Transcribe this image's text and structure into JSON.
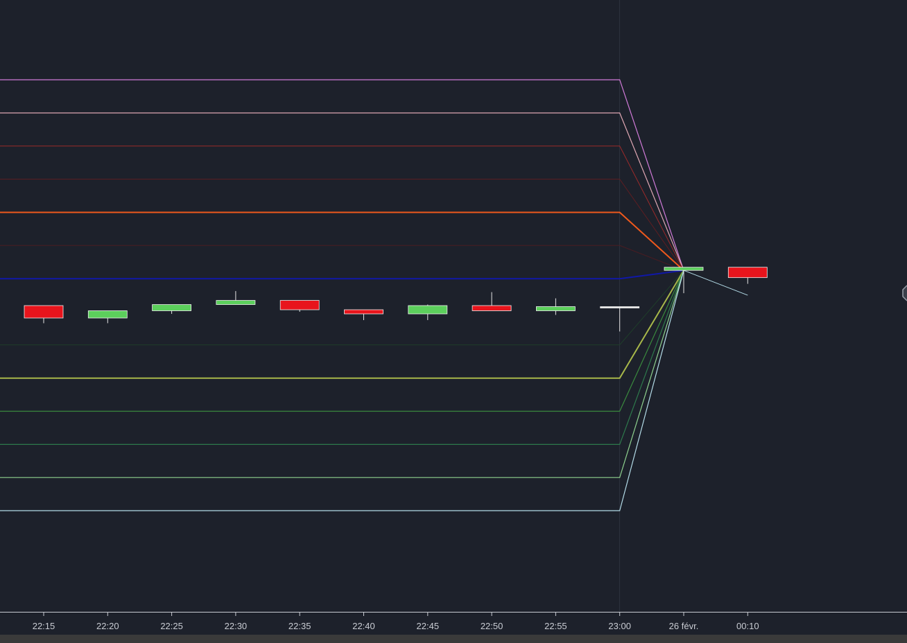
{
  "chart_data": {
    "type": "line",
    "x_ticks": [
      "22:15",
      "22:20",
      "22:25",
      "22:30",
      "22:35",
      "22:40",
      "22:45",
      "22:50",
      "22:55",
      "23:00",
      "26 févr.",
      "00:10"
    ],
    "grid": false,
    "candles": [
      {
        "time": "22:15",
        "open": 0.3,
        "close": -0.3,
        "high": 0.3,
        "low": -0.55,
        "color": "#e8141c"
      },
      {
        "time": "22:20",
        "open": -0.3,
        "close": 0.05,
        "high": 0.05,
        "low": -0.55,
        "color": "#5ccf5c"
      },
      {
        "time": "22:25",
        "open": 0.05,
        "close": 0.35,
        "high": 0.35,
        "low": -0.1,
        "color": "#5ccf5c"
      },
      {
        "time": "22:30",
        "open": 0.35,
        "close": 0.55,
        "high": 1.0,
        "low": 0.35,
        "color": "#5ccf5c"
      },
      {
        "time": "22:35",
        "open": 0.55,
        "close": 0.1,
        "high": 0.55,
        "low": 0.0,
        "color": "#e8141c"
      },
      {
        "time": "22:40",
        "open": 0.1,
        "close": -0.1,
        "high": 0.1,
        "low": -0.4,
        "color": "#e8141c"
      },
      {
        "time": "22:45",
        "open": -0.1,
        "close": 0.3,
        "high": 0.35,
        "low": -0.4,
        "color": "#5ccf5c"
      },
      {
        "time": "22:50",
        "open": 0.3,
        "close": 0.05,
        "high": 0.95,
        "low": 0.05,
        "color": "#e8141c"
      },
      {
        "time": "22:55",
        "open": 0.05,
        "close": 0.25,
        "high": 0.65,
        "low": -0.15,
        "color": "#5ccf5c"
      },
      {
        "time": "23:00",
        "open": 0.25,
        "close": 0.25,
        "high": 0.25,
        "low": -0.95,
        "color": "#e6e6e6"
      },
      {
        "time": "26 févr.",
        "open": 2.0,
        "close": 2.15,
        "high": 2.15,
        "low": 0.9,
        "color": "#5ccf5c"
      },
      {
        "time": "00:10",
        "open": 2.15,
        "close": 1.65,
        "high": 2.15,
        "low": 1.35,
        "color": "#e8141c"
      }
    ],
    "series": [
      {
        "color": "#d17bd9",
        "width": 1.2,
        "values": [
          11.2,
          11.2,
          11.2,
          11.2,
          11.2,
          11.2,
          11.2,
          11.2,
          11.2,
          11.2,
          2.0
        ]
      },
      {
        "color": "#e0a8b4",
        "width": 1.2,
        "values": [
          9.6,
          9.6,
          9.6,
          9.6,
          9.6,
          9.6,
          9.6,
          9.6,
          9.6,
          9.6,
          2.0
        ]
      },
      {
        "color": "#9c2a2a",
        "width": 1.0,
        "values": [
          8.0,
          8.0,
          8.0,
          8.0,
          8.0,
          8.0,
          8.0,
          8.0,
          8.0,
          8.0,
          2.0
        ]
      },
      {
        "color": "#5e1e22",
        "width": 1.0,
        "values": [
          6.4,
          6.4,
          6.4,
          6.4,
          6.4,
          6.4,
          6.4,
          6.4,
          6.4,
          6.4,
          2.0
        ]
      },
      {
        "color": "#f0591c",
        "width": 2.0,
        "values": [
          4.8,
          4.8,
          4.8,
          4.8,
          4.8,
          4.8,
          4.8,
          4.8,
          4.8,
          4.8,
          2.0
        ]
      },
      {
        "color": "#4a1c22",
        "width": 1.0,
        "values": [
          3.2,
          3.2,
          3.2,
          3.2,
          3.2,
          3.2,
          3.2,
          3.2,
          3.2,
          3.2,
          2.0
        ]
      },
      {
        "color": "#1018a8",
        "width": 2.0,
        "values": [
          1.6,
          1.6,
          1.6,
          1.6,
          1.6,
          1.6,
          1.6,
          1.6,
          1.6,
          1.6,
          2.0
        ]
      },
      {
        "color": "#1f3f2a",
        "width": 1.0,
        "values": [
          -1.6,
          -1.6,
          -1.6,
          -1.6,
          -1.6,
          -1.6,
          -1.6,
          -1.6,
          -1.6,
          -1.6,
          2.0
        ]
      },
      {
        "color": "#a8b84a",
        "width": 2.0,
        "values": [
          -3.2,
          -3.2,
          -3.2,
          -3.2,
          -3.2,
          -3.2,
          -3.2,
          -3.2,
          -3.2,
          -3.2,
          2.0
        ]
      },
      {
        "color": "#3a8a3e",
        "width": 1.2,
        "values": [
          -4.8,
          -4.8,
          -4.8,
          -4.8,
          -4.8,
          -4.8,
          -4.8,
          -4.8,
          -4.8,
          -4.8,
          2.0
        ]
      },
      {
        "color": "#2e7a4c",
        "width": 1.2,
        "values": [
          -6.4,
          -6.4,
          -6.4,
          -6.4,
          -6.4,
          -6.4,
          -6.4,
          -6.4,
          -6.4,
          -6.4,
          2.0
        ]
      },
      {
        "color": "#8fd28f",
        "width": 1.2,
        "values": [
          -8.0,
          -8.0,
          -8.0,
          -8.0,
          -8.0,
          -8.0,
          -8.0,
          -8.0,
          -8.0,
          -8.0,
          2.0
        ]
      },
      {
        "color": "#b4dce8",
        "width": 1.2,
        "values": [
          -9.6,
          -9.6,
          -9.6,
          -9.6,
          -9.6,
          -9.6,
          -9.6,
          -9.6,
          -9.6,
          -9.6,
          2.0
        ]
      }
    ],
    "colors": {
      "background": "#1d212b",
      "axis": "#c9ccd3",
      "crosshair": "#2c313c"
    }
  }
}
